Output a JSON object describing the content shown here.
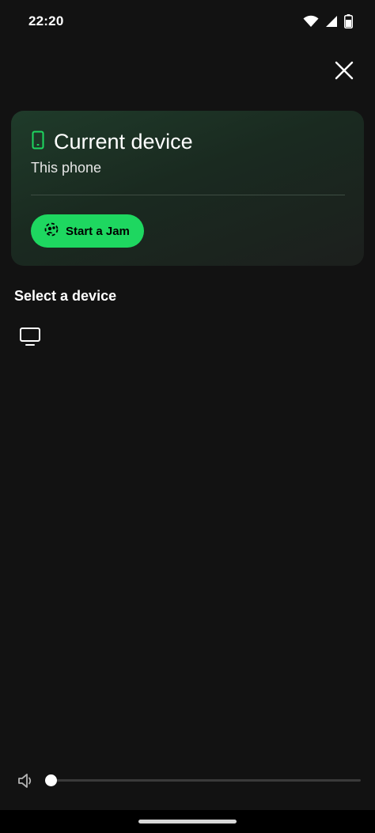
{
  "status_bar": {
    "time": "22:20",
    "icons": [
      "wifi-icon",
      "cell-signal-icon",
      "battery-icon"
    ]
  },
  "header": {
    "close_icon": "close-icon"
  },
  "current_device": {
    "icon": "phone-icon",
    "title": "Current device",
    "subtitle": "This phone",
    "jam_button_label": "Start a Jam",
    "jam_icon": "jam-icon"
  },
  "device_list": {
    "section_title": "Select a device",
    "items": [
      {
        "icon": "tv-icon"
      }
    ]
  },
  "volume": {
    "level": 0.0,
    "icon": "speaker-icon"
  },
  "colors": {
    "background": "#121212",
    "accent": "#1ed760",
    "card_gradient_start": "#1f3b2a",
    "text": "#ffffff"
  }
}
